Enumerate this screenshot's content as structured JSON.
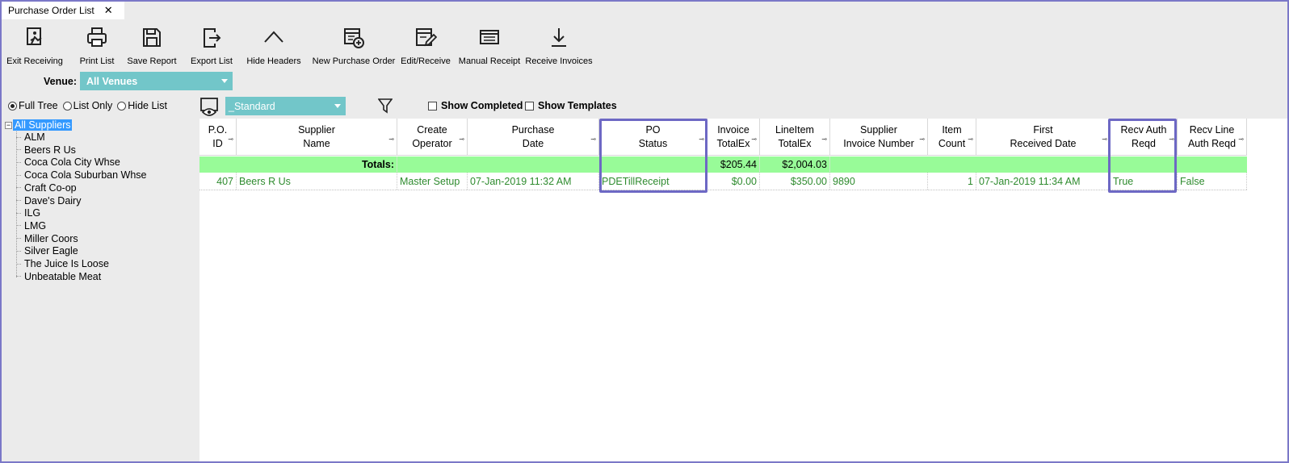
{
  "tab": {
    "title": "Purchase Order List",
    "close": "✕"
  },
  "toolbar": [
    {
      "label": "Exit Receiving",
      "icon": "exit-receiving-icon"
    },
    {
      "label": "Print List",
      "icon": "printer-icon"
    },
    {
      "label": "Save Report",
      "icon": "save-icon"
    },
    {
      "label": "Export List",
      "icon": "export-icon"
    },
    {
      "label": "Hide Headers",
      "icon": "chevron-up-icon"
    },
    {
      "label": "New Purchase Order",
      "icon": "new-document-icon"
    },
    {
      "label": "Edit/Receive",
      "icon": "edit-icon"
    },
    {
      "label": "Manual Receipt",
      "icon": "receipt-icon"
    },
    {
      "label": "Receive Invoices",
      "icon": "download-icon"
    }
  ],
  "venue": {
    "label": "Venue:",
    "value": "All Venues"
  },
  "view_modes": [
    {
      "label": "Full Tree",
      "selected": true
    },
    {
      "label": "List Only",
      "selected": false
    },
    {
      "label": "Hide List",
      "selected": false
    }
  ],
  "layout_select": {
    "value": "_Standard"
  },
  "show_completed": {
    "label": "Show Completed",
    "checked": false
  },
  "show_templates": {
    "label": "Show Templates",
    "checked": false
  },
  "tree": {
    "root": "All Suppliers",
    "items": [
      "ALM",
      "Beers R Us",
      "Coca Cola City Whse",
      "Coca Cola Suburban Whse",
      "Craft Co-op",
      "Dave's Dairy",
      "ILG",
      "LMG",
      "Miller Coors",
      "Silver Eagle",
      "The Juice Is Loose",
      "Unbeatable Meat"
    ]
  },
  "grid": {
    "columns": [
      {
        "line1": "P.O.",
        "line2": "ID"
      },
      {
        "line1": "Supplier",
        "line2": "Name"
      },
      {
        "line1": "Create",
        "line2": "Operator"
      },
      {
        "line1": "Purchase",
        "line2": "Date"
      },
      {
        "line1": "PO",
        "line2": "Status"
      },
      {
        "line1": "Invoice",
        "line2": "TotalEx"
      },
      {
        "line1": "LineItem",
        "line2": "TotalEx"
      },
      {
        "line1": "Supplier",
        "line2": "Invoice Number"
      },
      {
        "line1": "Item",
        "line2": "Count"
      },
      {
        "line1": "First",
        "line2": "Received Date"
      },
      {
        "line1": "Recv Auth",
        "line2": "Reqd"
      },
      {
        "line1": "Recv Line",
        "line2": "Auth Reqd"
      }
    ],
    "totals": {
      "label": "Totals:",
      "invoice_total": "$205.44",
      "lineitem_total": "$2,004.03"
    },
    "rows": [
      {
        "po_id": "407",
        "supplier": "Beers R Us",
        "operator": "Master Setup",
        "purchase_date": "07-Jan-2019 11:32 AM",
        "status": "PDETillReceipt",
        "invoice_total": "$0.00",
        "lineitem_total": "$350.00",
        "invoice_number": "9890",
        "item_count": "1",
        "first_received": "07-Jan-2019 11:34 AM",
        "recv_auth": "True",
        "recv_line_auth": "False"
      }
    ]
  },
  "colors": {
    "accent": "#72c6c9",
    "totals_bg": "#98fb98",
    "row_text": "#2e8b2e",
    "highlight": "#6d68c4",
    "tree_select": "#3399ff"
  }
}
